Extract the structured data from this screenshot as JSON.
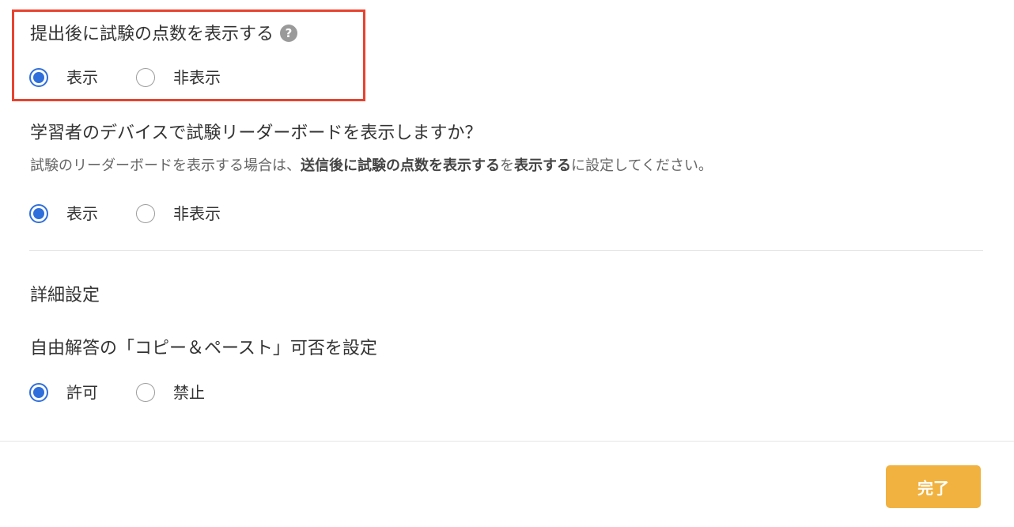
{
  "sections": {
    "show_score": {
      "title": "提出後に試験の点数を表示する",
      "help_icon": "question-circle-icon",
      "options": [
        {
          "label": "表示",
          "selected": true
        },
        {
          "label": "非表示",
          "selected": false
        }
      ]
    },
    "leaderboard": {
      "title": "学習者のデバイスで試験リーダーボードを表示しますか？",
      "note_prefix": "試験のリーダーボードを表示する場合は、",
      "note_bold1": "送信後に試験の点数を表示する",
      "note_mid": "を",
      "note_bold2": "表示する",
      "note_suffix": "に設定してください。",
      "options": [
        {
          "label": "表示",
          "selected": true
        },
        {
          "label": "非表示",
          "selected": false
        }
      ]
    },
    "advanced": {
      "title": "詳細設定"
    },
    "copy_paste": {
      "title": "自由解答の「コピー＆ペースト」可否を設定",
      "options": [
        {
          "label": "許可",
          "selected": true
        },
        {
          "label": "禁止",
          "selected": false
        }
      ]
    }
  },
  "footer": {
    "done_label": "完了"
  },
  "colors": {
    "accent_blue": "#2f6fdb",
    "highlight_red": "#e8432f",
    "button_yellow": "#f1b23f"
  }
}
